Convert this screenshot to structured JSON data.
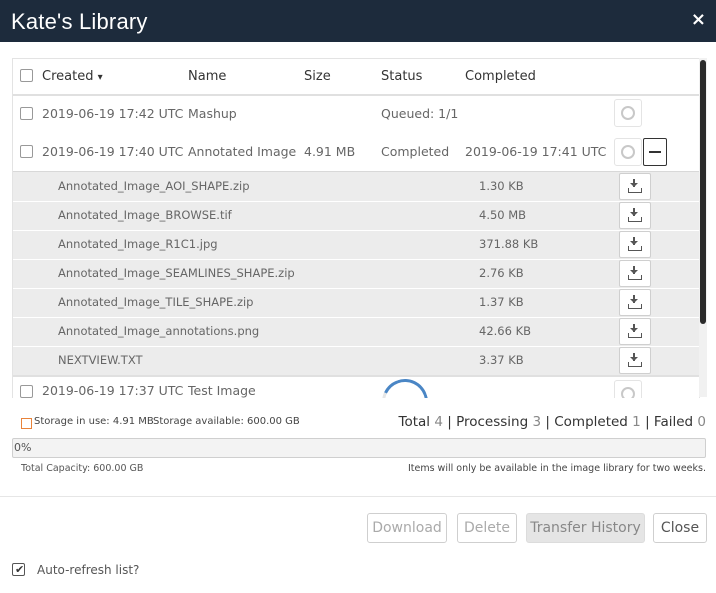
{
  "window": {
    "title": "Kate's Library",
    "close_glyph": "×"
  },
  "table": {
    "columns": {
      "created": "Created",
      "name": "Name",
      "size": "Size",
      "status": "Status",
      "completed": "Completed"
    },
    "sort_indicator": "▾",
    "rows": [
      {
        "created": "2019-06-19 17:42 UTC",
        "name": "Mashup",
        "size": "",
        "status": "Queued: 1/1",
        "completed": ""
      },
      {
        "created": "2019-06-19 17:40 UTC",
        "name": "Annotated Image",
        "size": "4.91 MB",
        "status": "Completed",
        "completed": "2019-06-19 17:41 UTC"
      },
      {
        "created": "2019-06-19 17:37 UTC",
        "name": "Test Image",
        "size": "",
        "status": "",
        "completed": ""
      }
    ],
    "files": [
      {
        "name": "Annotated_Image_AOI_SHAPE.zip",
        "size": "1.30 KB"
      },
      {
        "name": "Annotated_Image_BROWSE.tif",
        "size": "4.50 MB"
      },
      {
        "name": "Annotated_Image_R1C1.jpg",
        "size": "371.88 KB"
      },
      {
        "name": "Annotated_Image_SEAMLINES_SHAPE.zip",
        "size": "2.76 KB"
      },
      {
        "name": "Annotated_Image_TILE_SHAPE.zip",
        "size": "1.37 KB"
      },
      {
        "name": "Annotated_Image_annotations.png",
        "size": "42.66 KB"
      },
      {
        "name": "NEXTVIEW.TXT",
        "size": "3.37 KB"
      }
    ]
  },
  "storage": {
    "in_use_label": "Storage in use:",
    "in_use": "4.91 MB",
    "available_label": "Storage available:",
    "available": "600.00 GB",
    "total_label": "Total",
    "total": "4",
    "processing_label": "Processing",
    "processing": "3",
    "completed_label": "Completed",
    "completed": "1",
    "failed_label": "Failed",
    "failed": "0",
    "separator": "|",
    "progress_percent": 0,
    "progress_label": "0%",
    "capacity_label": "Total Capacity:",
    "capacity": "600.00 GB",
    "note": "Items will only be available in the image library for two weeks."
  },
  "buttons": {
    "download": "Download",
    "delete": "Delete",
    "transfer_history": "Transfer History",
    "close": "Close"
  },
  "auto_refresh": {
    "label": "Auto-refresh list?",
    "checked": true,
    "check_glyph": "✔"
  },
  "colors": {
    "titlebar": "#1d2b3c",
    "accent": "#4a86c5",
    "storage_legend": "#e8833a"
  },
  "icons": {
    "row_action": "cog-icon",
    "expand": "minus-icon",
    "file_action": "download-icon"
  }
}
